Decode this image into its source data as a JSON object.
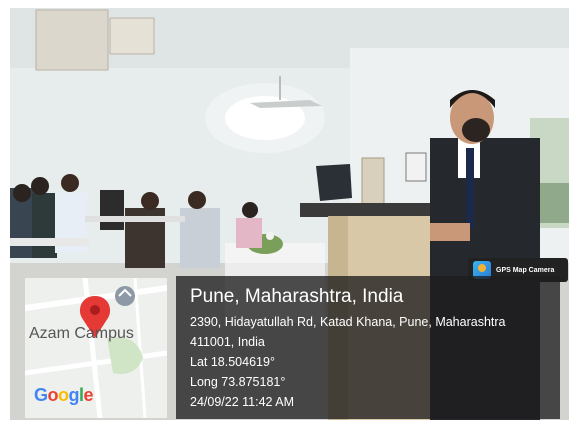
{
  "badge": {
    "text": "GPS Map Camera",
    "icon": "gps-map-camera-icon"
  },
  "location": {
    "title": "Pune, Maharashtra, India",
    "address_line1": "2390, Hidayatullah Rd, Katad Khana, Pune, Maharashtra",
    "address_line2": "411001, India",
    "lat": "Lat 18.504619°",
    "long": "Long 73.875181°",
    "datetime": "24/09/22 11:42 AM"
  },
  "map": {
    "place_label": "Azam Campus",
    "brand": "Google",
    "pin_color": "#e53935"
  }
}
